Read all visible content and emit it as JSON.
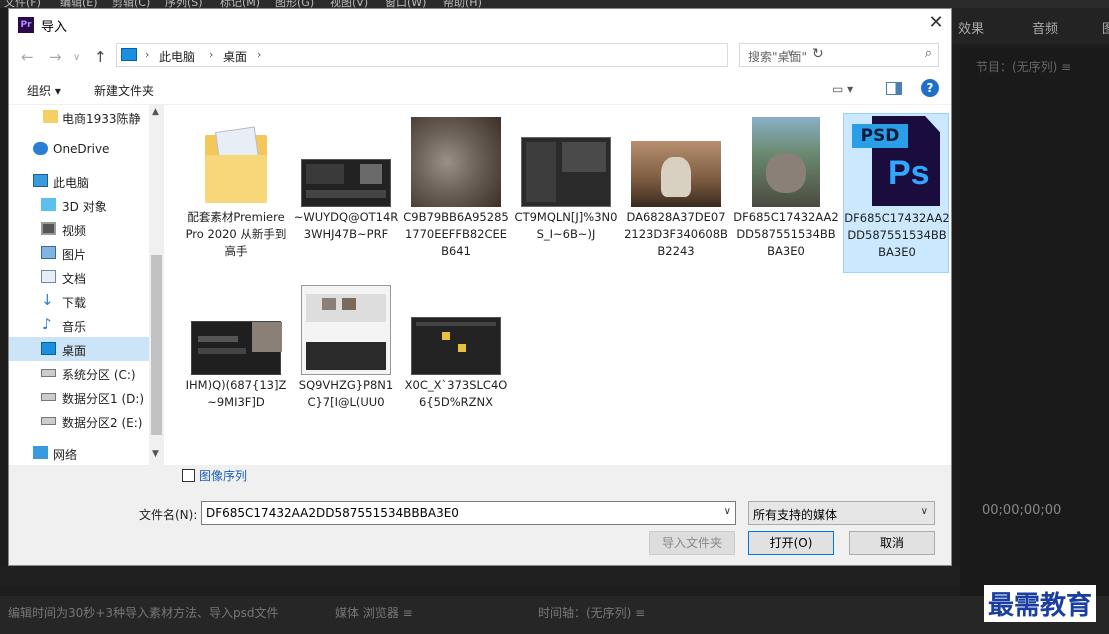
{
  "premiere": {
    "menu_items": [
      "文件(F)",
      "编辑(E)",
      "剪辑(C)",
      "序列(S)",
      "标记(M)",
      "图形(G)",
      "视图(V)",
      "窗口(W)",
      "帮助(H)"
    ],
    "right_tabs": [
      "效果",
      "音频",
      "图"
    ],
    "program_title": "节目：(无序列) ≡",
    "timecode": "00;00;00;00",
    "bottom_left_text": "编辑时间为30秒+3种导入素材方法、导入psd文件",
    "media_browser_tab": "媒体 浏览器 ≡",
    "timeline_tab": "时间轴：(无序列) ≡",
    "watermark": "最需教育"
  },
  "dialog": {
    "title": "导入",
    "app_icon_text": "Pr",
    "address": [
      "此电脑",
      "桌面"
    ],
    "search_placeholder": "搜索\"桌面\"",
    "organize_label": "组织 ▾",
    "new_folder_label": "新建文件夹",
    "nav_items": [
      {
        "label": "电商1933陈静",
        "icon": "folder-icon"
      },
      {
        "label": "OneDrive",
        "icon": "cloud-icon"
      },
      {
        "label": "此电脑",
        "icon": "computer-icon"
      },
      {
        "label": "3D 对象",
        "icon": "cube-icon"
      },
      {
        "label": "视频",
        "icon": "video-icon"
      },
      {
        "label": "图片",
        "icon": "picture-icon"
      },
      {
        "label": "文档",
        "icon": "document-icon"
      },
      {
        "label": "下载",
        "icon": "download-icon"
      },
      {
        "label": "音乐",
        "icon": "music-icon"
      },
      {
        "label": "桌面",
        "icon": "desktop-icon"
      },
      {
        "label": "系统分区 (C:)",
        "icon": "drive-icon"
      },
      {
        "label": "数据分区1 (D:)",
        "icon": "drive-icon"
      },
      {
        "label": "数据分区2 (E:)",
        "icon": "drive-icon"
      },
      {
        "label": "网络",
        "icon": "network-icon"
      }
    ],
    "files": [
      {
        "name": "配套素材Premiere Pro 2020 从新手到高手",
        "kind": "folder"
      },
      {
        "name": "~WUYDQ@OT14R3WHJ47B~PRF",
        "kind": "screenshot-dark"
      },
      {
        "name": "C9B79BB6A952851770EEFFB82CEEB641",
        "kind": "cat-photo"
      },
      {
        "name": "CT9MQLN[J]%3N0S_I~6B~)J",
        "kind": "screenshot-dark"
      },
      {
        "name": "DA6828A37DE072123D3F340608BB2243",
        "kind": "cat-photo"
      },
      {
        "name": "DF685C17432AA2DD587551534BBBA3E0",
        "kind": "cat-window-photo"
      },
      {
        "name": "DF685C17432AA2DD587551534BBBA3E0",
        "kind": "psd-file"
      },
      {
        "name": "IHM)Q)(687{13]Z~9MI3F]D",
        "kind": "screenshot-dark"
      },
      {
        "name": "SQ9VHZG}P8N1C}7[I@L(UU0",
        "kind": "screenshot-light"
      },
      {
        "name": "X0C_X`373SLC4O6{5D%RZNX",
        "kind": "screenshot-dark"
      }
    ],
    "psd_label": "PSD",
    "ps_label": "Ps",
    "image_sequence_label": "图像序列",
    "filename_label": "文件名(N):",
    "filename_value": "DF685C17432AA2DD587551534BBBA3E0",
    "filetype_value": "所有支持的媒体",
    "import_folder_label": "导入文件夹",
    "open_label": "打开(O)",
    "cancel_label": "取消"
  }
}
